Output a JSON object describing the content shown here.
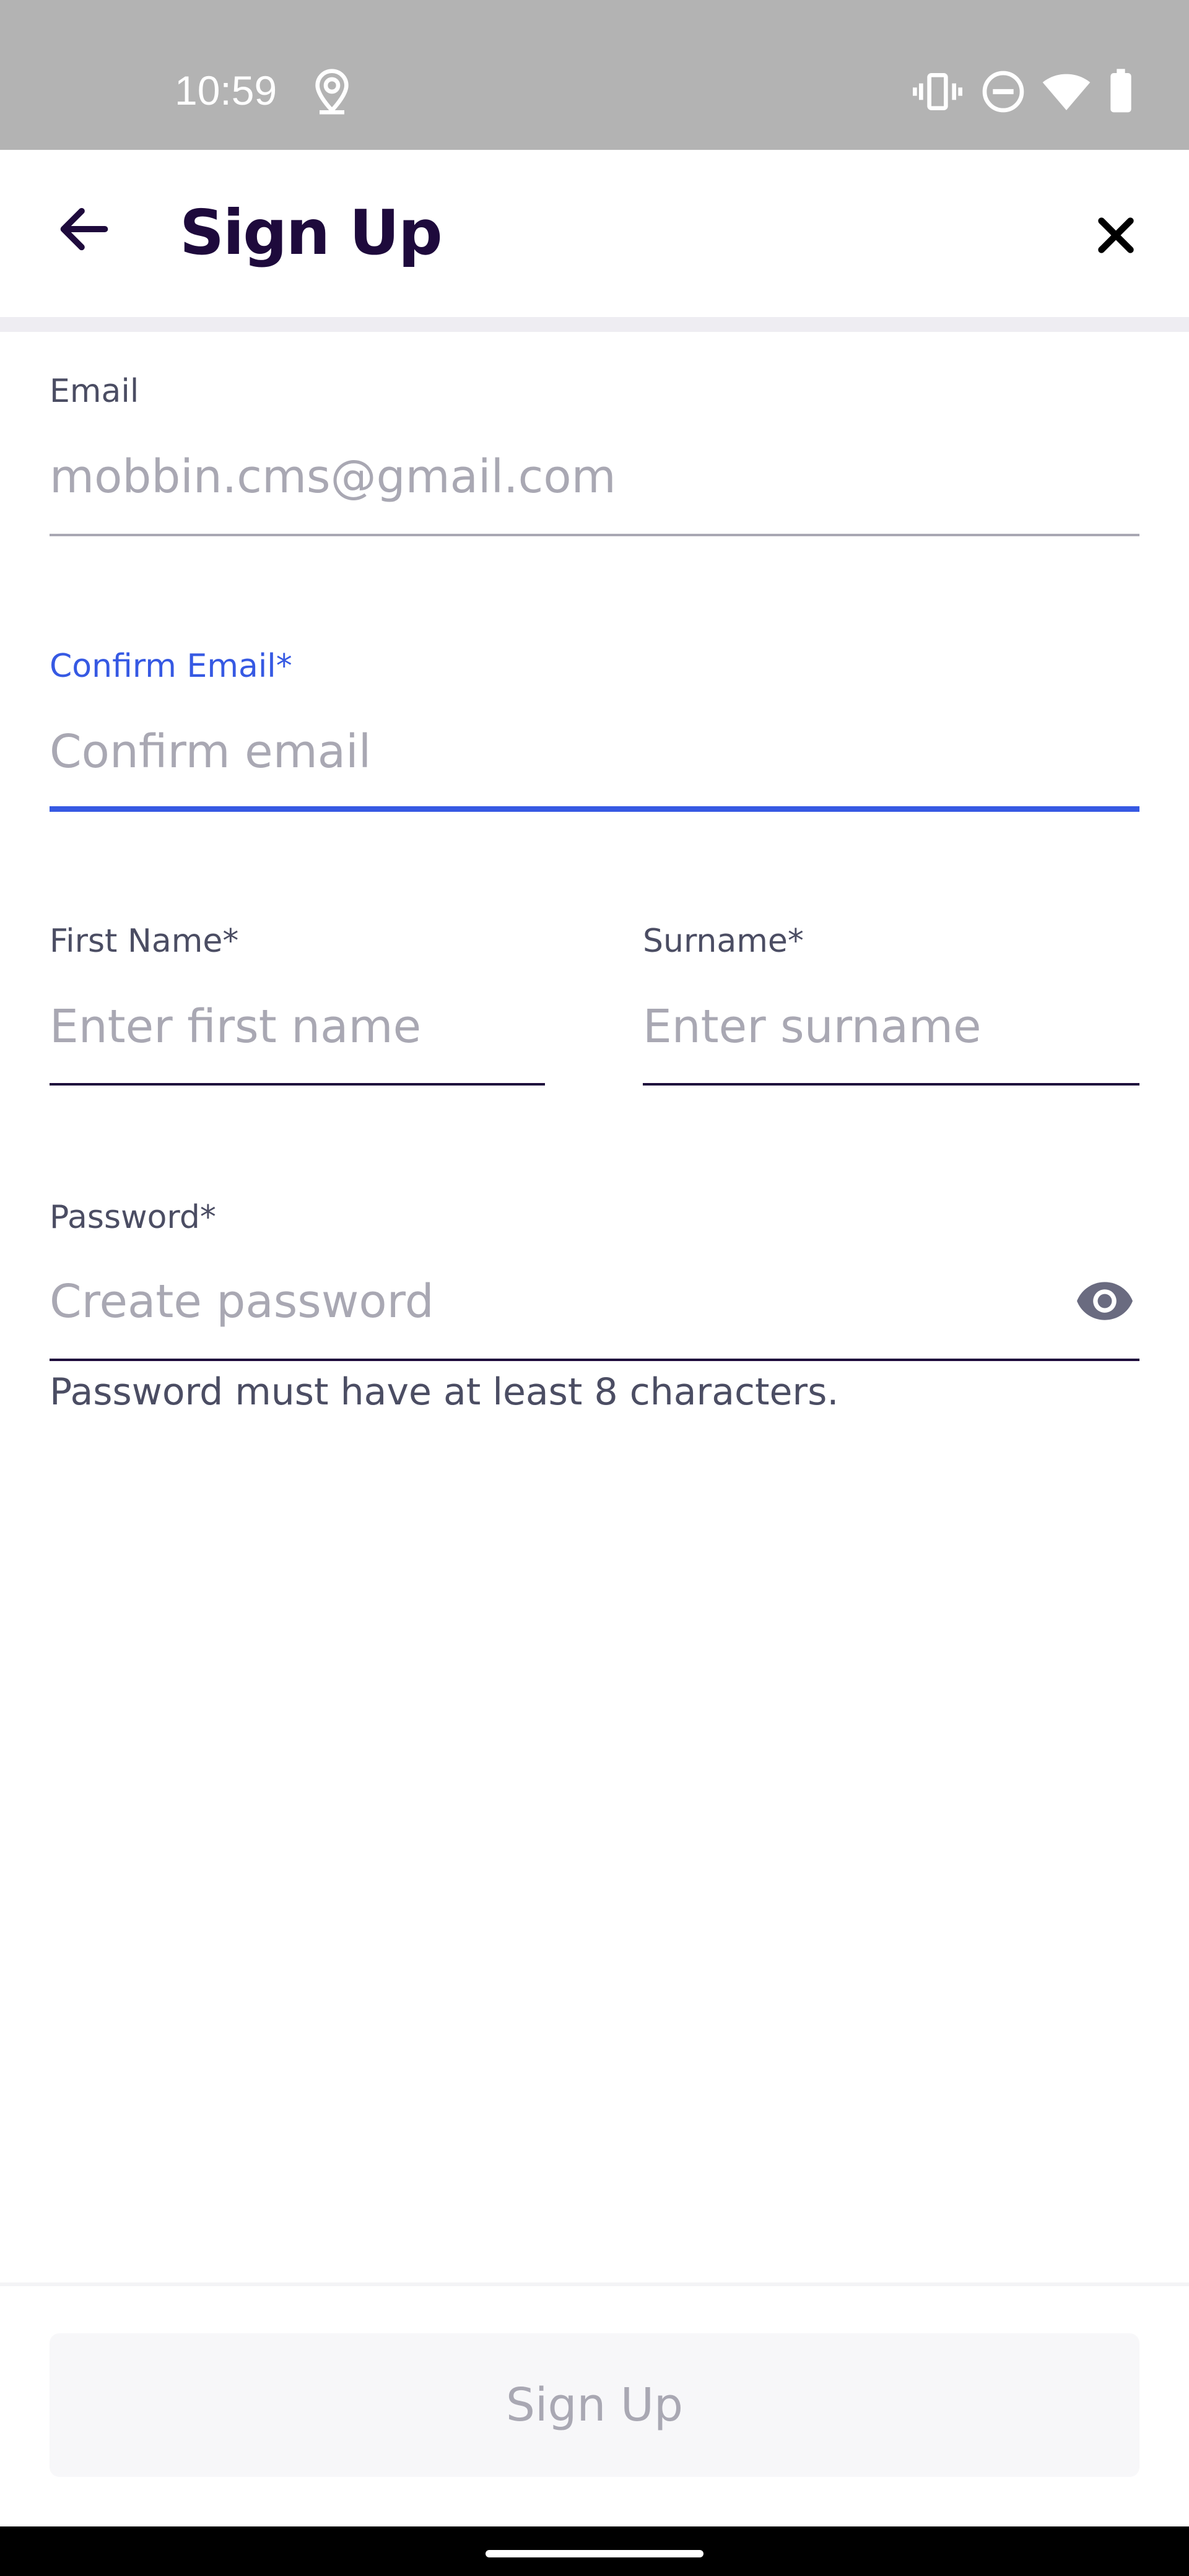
{
  "status_bar": {
    "time": "10:59",
    "icons": [
      "location-icon",
      "vibrate-icon",
      "do-not-disturb-icon",
      "wifi-icon",
      "battery-icon"
    ]
  },
  "header": {
    "title": "Sign Up",
    "back_icon": "arrow-left-icon",
    "close_icon": "close-icon"
  },
  "form": {
    "email": {
      "label": "Email",
      "value": "mobbin.cms@gmail.com"
    },
    "confirm_email": {
      "label": "Confirm Email*",
      "placeholder": "Confirm email"
    },
    "first_name": {
      "label": "First Name*",
      "placeholder": "Enter first name"
    },
    "surname": {
      "label": "Surname*",
      "placeholder": "Enter surname"
    },
    "password": {
      "label": "Password*",
      "placeholder": "Create password",
      "helper": "Password must have at least 8 characters.",
      "toggle_icon": "eye-icon"
    }
  },
  "footer": {
    "signup_label": "Sign Up"
  },
  "colors": {
    "accent": "#3659e3",
    "text_dark": "#1e0a3c",
    "text_muted": "#a9a8b3",
    "status_bar": "#b3b3b3"
  }
}
